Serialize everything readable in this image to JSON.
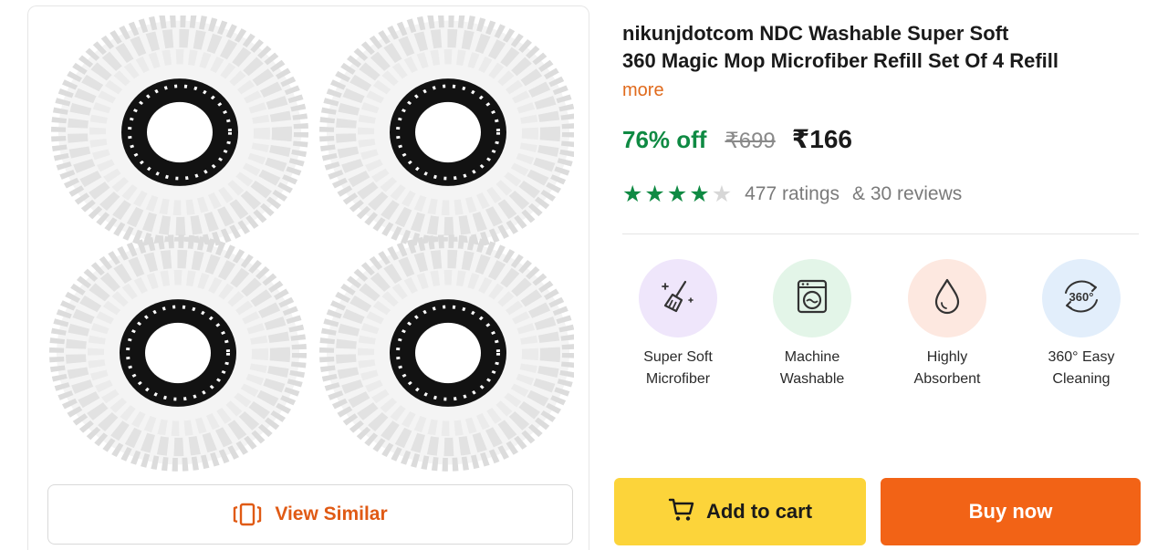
{
  "product": {
    "title_line1": "nikunjdotcom NDC Washable Super Soft",
    "title_line2": "360 Magic Mop Microfiber Refill Set Of 4 Refill",
    "more_label": "more",
    "image_description_icon": "mop-refill-image"
  },
  "pricing": {
    "discount": "76% off",
    "mrp": "₹699",
    "price": "₹166",
    "discount_color": "#0f8a43"
  },
  "rating": {
    "stars": 4,
    "max_stars": 5,
    "ratings_text": "477 ratings",
    "reviews_text": "& 30 reviews",
    "star_color": "#0f8a43"
  },
  "features": [
    {
      "line1": "Super Soft",
      "line2": "Microfiber",
      "icon": "broom-sparkle-icon",
      "bg": "#efe6fb"
    },
    {
      "line1": "Machine",
      "line2": "Washable",
      "icon": "washing-machine-icon",
      "bg": "#e3f5e8"
    },
    {
      "line1": "Highly",
      "line2": "Absorbent",
      "icon": "water-drop-icon",
      "bg": "#fde8e0"
    },
    {
      "line1": "360° Easy",
      "line2": "Cleaning",
      "icon": "rotate-360-icon",
      "bg": "#e2eefb"
    }
  ],
  "actions": {
    "view_similar": "View Similar",
    "add_to_cart": "Add to cart",
    "buy_now": "Buy now",
    "add_to_cart_color": "#fcd43a",
    "buy_now_color": "#f26316"
  }
}
